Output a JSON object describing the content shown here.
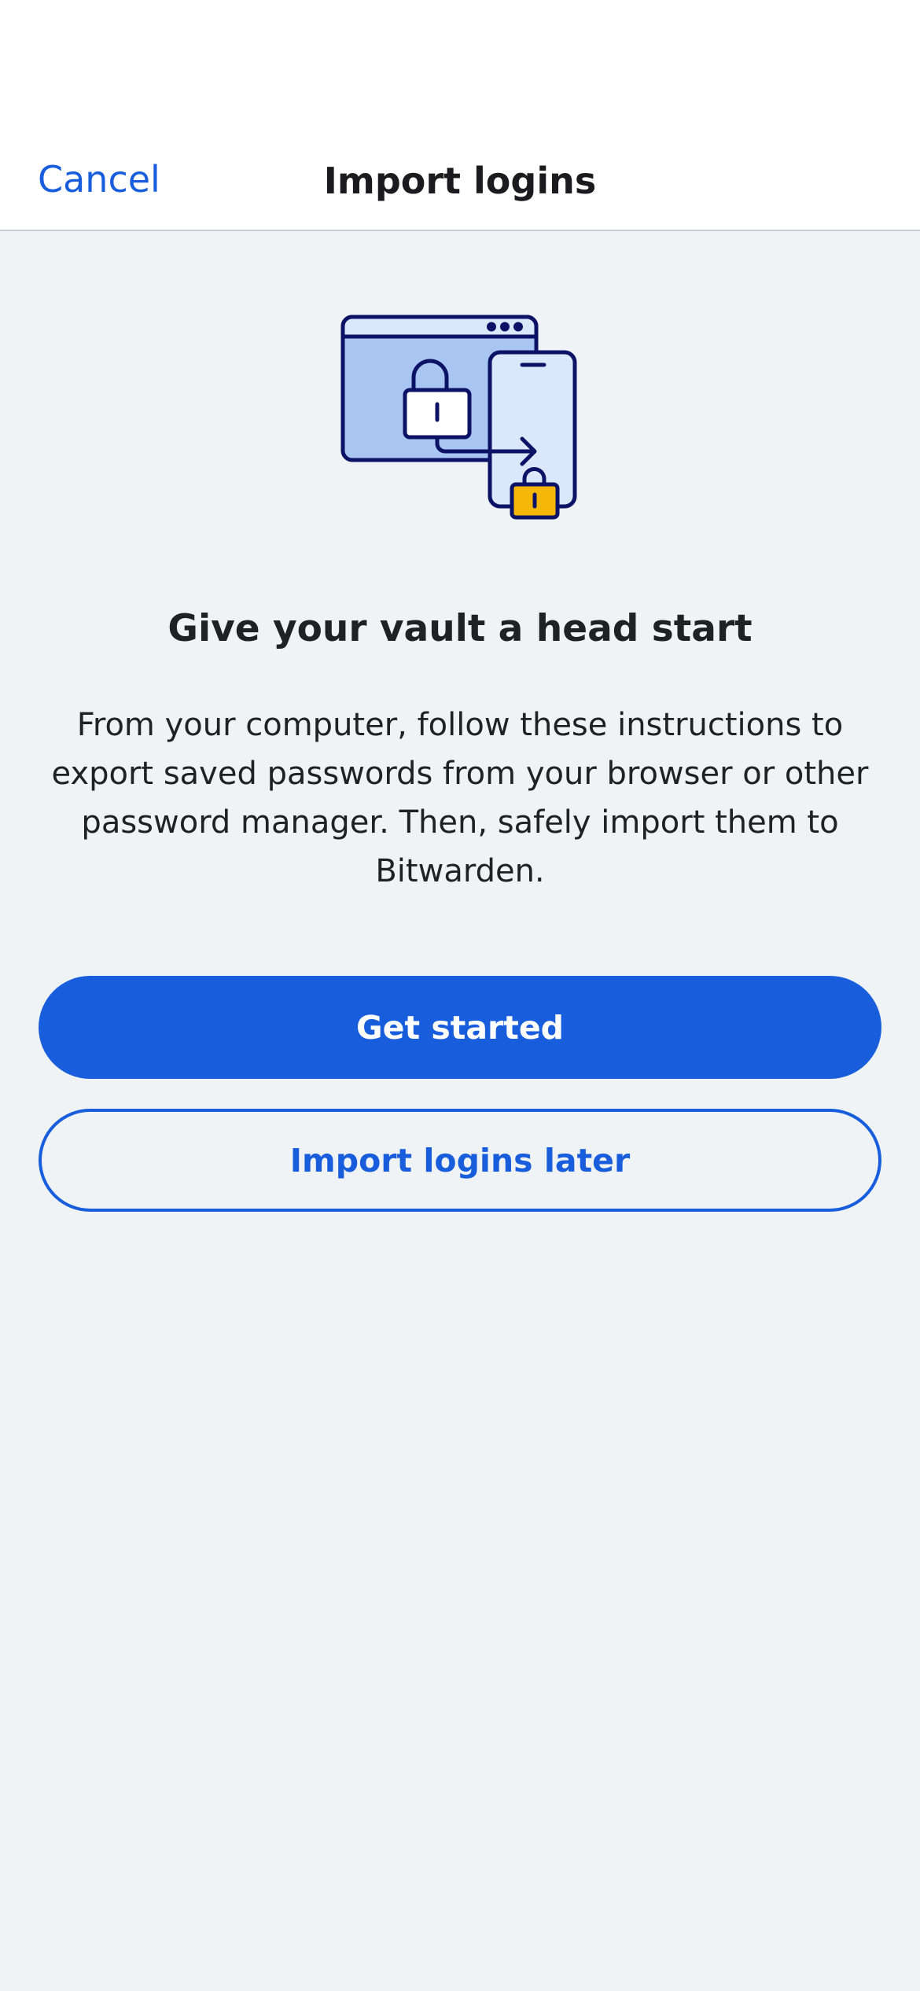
{
  "nav": {
    "cancel_label": "Cancel",
    "title": "Import logins"
  },
  "illustration": {
    "icon": "browser-to-phone-import-icon",
    "colors": {
      "outline": "#0c1366",
      "browser_fill": "#a9c5f2",
      "phone_fill": "#dbe7fb",
      "lock_accent": "#f5b80a"
    }
  },
  "content": {
    "headline": "Give your vault a head start",
    "description": "From your computer, follow these instructions to export saved passwords from your browser or other password manager. Then, safely import them to Bitwarden."
  },
  "actions": {
    "primary_label": "Get started",
    "secondary_label": "Import logins later"
  },
  "colors": {
    "accent": "#175ddc",
    "background": "#f0f3f6"
  }
}
